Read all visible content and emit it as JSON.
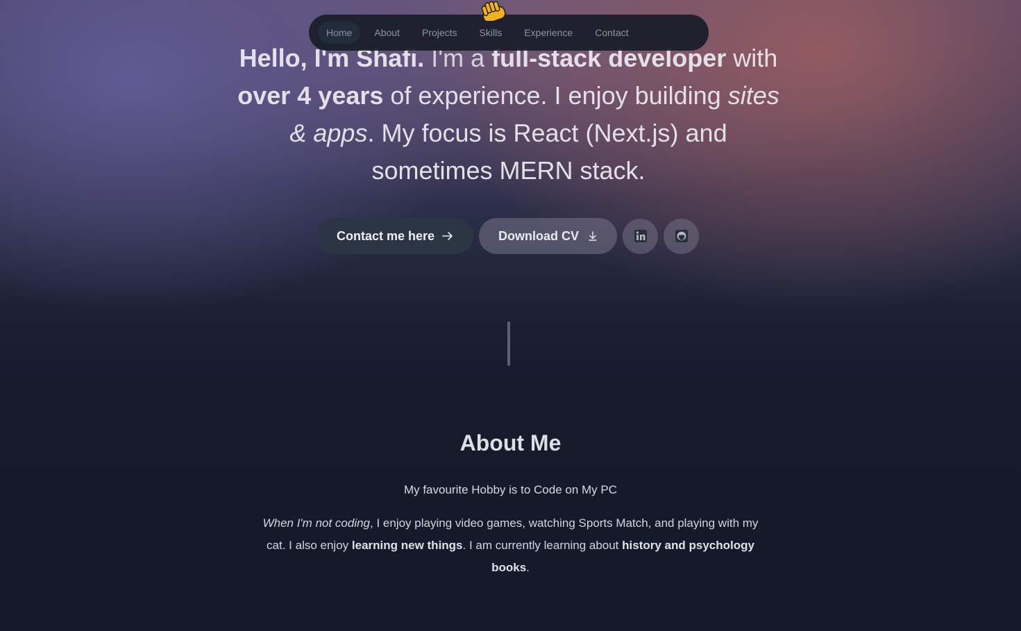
{
  "nav": {
    "items": [
      {
        "label": "Home",
        "active": true
      },
      {
        "label": "About"
      },
      {
        "label": "Projects"
      },
      {
        "label": "Skills"
      },
      {
        "label": "Experience"
      },
      {
        "label": "Contact"
      }
    ]
  },
  "hero": {
    "wave_icon": "waving-hand-icon",
    "intro": {
      "greeting": "Hello, I'm Shafi.",
      "t1": " I'm a ",
      "role": "full-stack developer",
      "t2": "with ",
      "years": "over 4 years",
      "t3": " of experience. I enjoy building ",
      "focus": "sites & apps",
      "t4": ". My focus is React (Next.js) and sometimes MERN stack."
    },
    "contact_button": {
      "label": "Contact me here",
      "icon": "arrow-right-icon"
    },
    "cv_button": {
      "label": "Download CV",
      "icon": "download-icon"
    },
    "linkedin_icon": "linkedin-icon",
    "github_icon": "github-icon"
  },
  "about": {
    "title": "About Me",
    "subtitle": "My favourite Hobby is to Code on My PC",
    "p_italic": "When I'm not coding",
    "p1": ", I enjoy playing video games, watching Sports Match, and playing with my cat. I also enjoy ",
    "p_b1": "learning new things",
    "p2": ". I am currently learning about ",
    "p_b2": "history and psychology books",
    "p3": "."
  },
  "colors": {
    "background": "#141a2a",
    "nav_bg": "#181c28",
    "contact_button": "#2c3543",
    "text": "#e4e0ea"
  }
}
